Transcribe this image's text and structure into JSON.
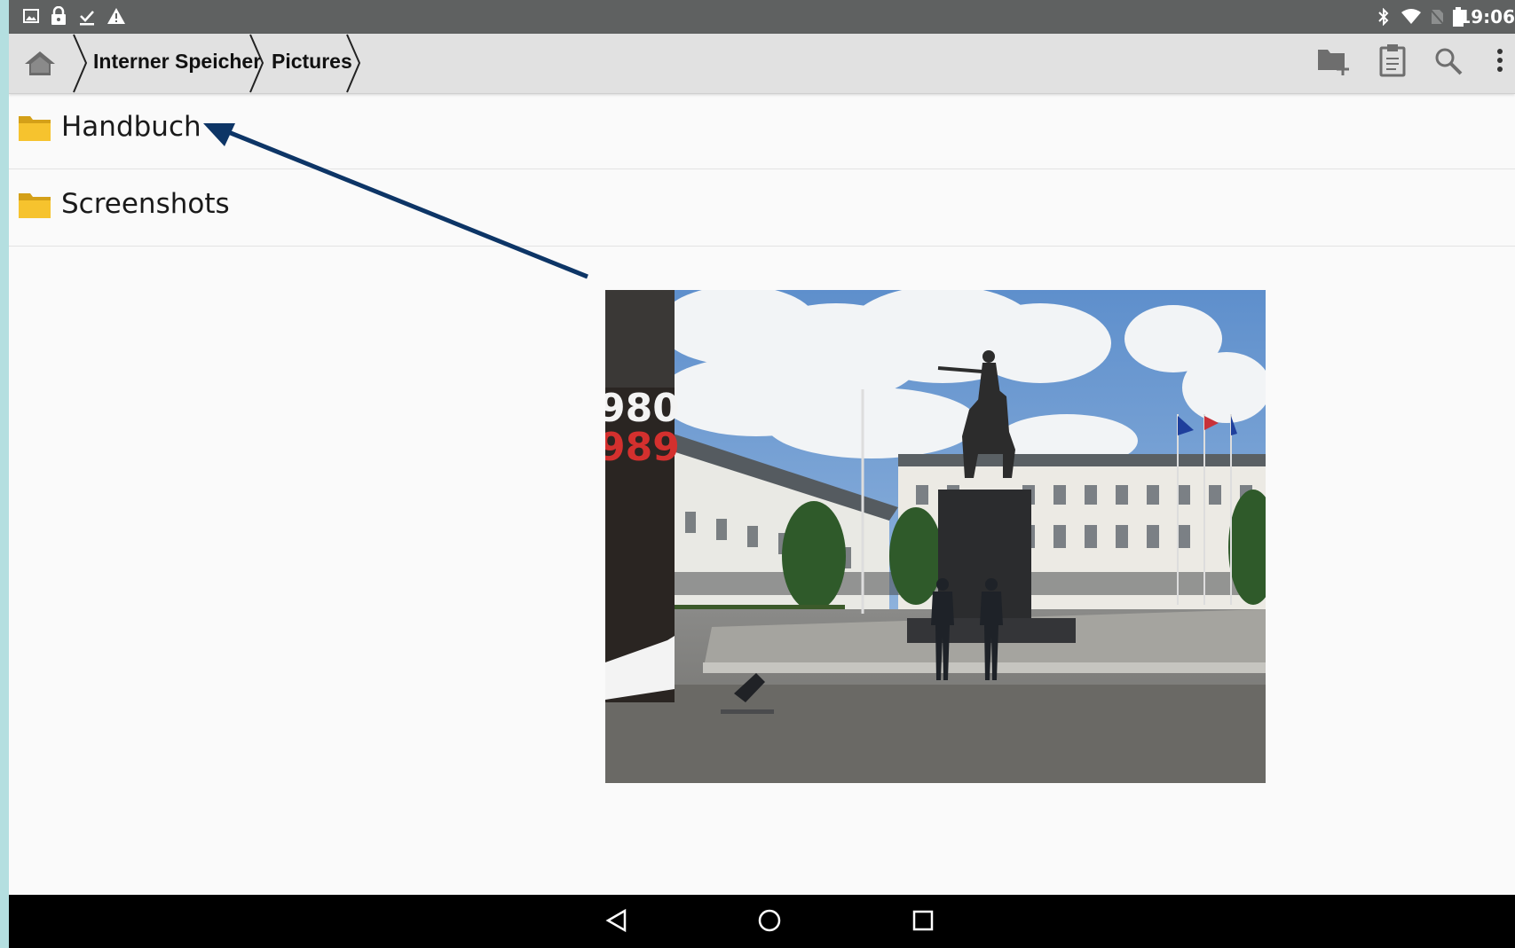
{
  "status_bar": {
    "time": "19:06",
    "left_icons": [
      "image-icon",
      "lock-icon",
      "download-done-icon",
      "warning-icon"
    ],
    "right_icons": [
      "bluetooth-icon",
      "wifi-icon",
      "no-sim-icon",
      "battery-icon"
    ]
  },
  "toolbar": {
    "home_icon": "home-icon",
    "breadcrumb": [
      "Interner Speicher",
      "Pictures"
    ],
    "actions": [
      "new-folder-icon",
      "clipboard-icon",
      "search-icon",
      "more-vert-icon"
    ]
  },
  "folders": [
    {
      "name": "Handbuch",
      "icon": "folder-icon"
    },
    {
      "name": "Screenshots",
      "icon": "folder-icon"
    }
  ],
  "annotation": {
    "type": "arrow",
    "color": "#0d3566",
    "points_to": "Handbuch"
  },
  "photo": {
    "subject": "Presidential Palace with equestrian statue and honor guards",
    "banner_text": "980 / 989"
  },
  "nav_bar": {
    "buttons": [
      "back-icon",
      "home-circle-icon",
      "recents-icon"
    ]
  },
  "colors": {
    "toolbar_bg": "#e1e1e1",
    "status_bg": "#5f6161",
    "folder_yellow": "#f6c32e",
    "arrow": "#0d3566"
  }
}
